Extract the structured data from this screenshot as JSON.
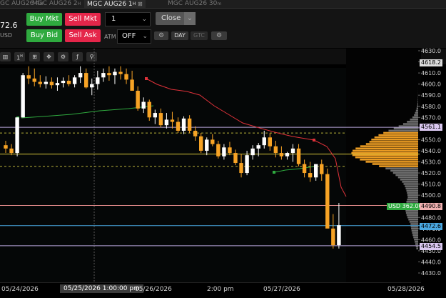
{
  "tabs": [
    {
      "label": "GC AUG26 4",
      "suffix": "H",
      "active": false
    },
    {
      "label": "MGC AUG26 2",
      "suffix": "H",
      "active": false
    },
    {
      "label": "MGC AUG26 1",
      "suffix": "H",
      "active": true
    },
    {
      "label": "MGC AUG26 30",
      "suffix": "m",
      "active": false
    }
  ],
  "account": {
    "price": "72.6",
    "currency": "USD"
  },
  "order_panel": {
    "buy_mkt": "Buy Mkt",
    "sell_mkt": "Sell Mkt",
    "buy_bid": "Buy Bid",
    "sell_ask": "Sell Ask",
    "quantity": "1",
    "close": "Close",
    "atm_label": "ATM",
    "atm_value": "OFF",
    "day": "DAY",
    "gtc": "GTC"
  },
  "chart_toolbar": {
    "interval": "1"
  },
  "price_axis": {
    "ticks": [
      "4630.0",
      "4620.0",
      "4610.0",
      "4600.0",
      "4590.0",
      "4580.0",
      "4570.0",
      "4560.0",
      "4550.0",
      "4540.0",
      "4530.0",
      "4520.0",
      "4510.0",
      "4500.0",
      "4490.0",
      "4480.0",
      "4470.0",
      "4460.0",
      "4450.0",
      "4440.0",
      "4430.0"
    ],
    "tags": {
      "high": "4618.2",
      "upper": "4561.1",
      "target": "4490.8",
      "position_pnl": "USD 362.00",
      "last": "4472.6",
      "low": "4454.5"
    }
  },
  "time_axis": {
    "labels": [
      "05/24/2026",
      "05/26/2026",
      "2:00 pm",
      "05/27/2026",
      "05/28/2026"
    ],
    "cursor": "05/25/2026 1:00:00 pm"
  },
  "colors": {
    "up": "#ffffff",
    "down": "#f7a325",
    "buy": "#2faa3f",
    "sell": "#e5264a",
    "stop_line": "#e0323a",
    "support_line": "#2faa3f"
  },
  "chart_data": {
    "type": "candlestick",
    "ylim": [
      4425,
      4635
    ],
    "candles": [
      [
        4545,
        4549,
        4538,
        4542
      ],
      [
        4542,
        4546,
        4536,
        4538
      ],
      [
        4538,
        4570,
        4535,
        4570
      ],
      [
        4570,
        4610,
        4570,
        4608
      ],
      [
        4608,
        4616,
        4600,
        4605
      ],
      [
        4605,
        4614,
        4598,
        4602
      ],
      [
        4602,
        4608,
        4597,
        4600
      ],
      [
        4600,
        4607,
        4596,
        4602
      ],
      [
        4602,
        4606,
        4596,
        4599
      ],
      [
        4599,
        4606,
        4594,
        4601
      ],
      [
        4601,
        4606,
        4597,
        4603
      ],
      [
        4603,
        4608,
        4598,
        4600
      ],
      [
        4600,
        4608,
        4597,
        4606
      ],
      [
        4606,
        4616,
        4601,
        4610
      ],
      [
        4610,
        4614,
        4596,
        4597
      ],
      [
        4597,
        4605,
        4590,
        4600
      ],
      [
        4600,
        4612,
        4595,
        4606
      ],
      [
        4606,
        4614,
        4602,
        4610
      ],
      [
        4610,
        4616,
        4603,
        4608
      ],
      [
        4608,
        4614,
        4600,
        4611
      ],
      [
        4611,
        4616,
        4604,
        4609
      ],
      [
        4609,
        4614,
        4600,
        4604
      ],
      [
        4604,
        4612,
        4596,
        4594
      ],
      [
        4594,
        4598,
        4576,
        4578
      ],
      [
        4578,
        4588,
        4574,
        4584
      ],
      [
        4584,
        4586,
        4567,
        4570
      ],
      [
        4570,
        4577,
        4564,
        4574
      ],
      [
        4574,
        4578,
        4561,
        4563
      ],
      [
        4563,
        4574,
        4560,
        4568
      ],
      [
        4568,
        4575,
        4560,
        4566
      ],
      [
        4566,
        4570,
        4556,
        4558
      ],
      [
        4558,
        4571,
        4555,
        4569
      ],
      [
        4569,
        4572,
        4556,
        4558
      ],
      [
        4558,
        4562,
        4549,
        4553
      ],
      [
        4553,
        4556,
        4538,
        4540
      ],
      [
        4540,
        4552,
        4536,
        4550
      ],
      [
        4550,
        4555,
        4544,
        4546
      ],
      [
        4546,
        4549,
        4533,
        4535
      ],
      [
        4535,
        4546,
        4532,
        4543
      ],
      [
        4543,
        4548,
        4536,
        4538
      ],
      [
        4538,
        4541,
        4527,
        4529
      ],
      [
        4529,
        4537,
        4516,
        4520
      ],
      [
        4520,
        4540,
        4518,
        4536
      ],
      [
        4536,
        4545,
        4532,
        4542
      ],
      [
        4542,
        4547,
        4535,
        4545
      ],
      [
        4545,
        4558,
        4542,
        4552
      ],
      [
        4552,
        4556,
        4540,
        4544
      ],
      [
        4544,
        4549,
        4534,
        4538
      ],
      [
        4538,
        4544,
        4532,
        4535
      ],
      [
        4535,
        4539,
        4532,
        4538
      ],
      [
        4538,
        4546,
        4530,
        4542
      ],
      [
        4542,
        4546,
        4526,
        4528
      ],
      [
        4528,
        4532,
        4516,
        4520
      ],
      [
        4520,
        4530,
        4512,
        4516
      ],
      [
        4516,
        4528,
        4513,
        4528
      ],
      [
        4528,
        4532,
        4513,
        4519
      ],
      [
        4519,
        4524,
        4478,
        4470
      ],
      [
        4470,
        4483,
        4452,
        4455
      ],
      [
        4455,
        4493,
        4452,
        4473
      ]
    ]
  }
}
